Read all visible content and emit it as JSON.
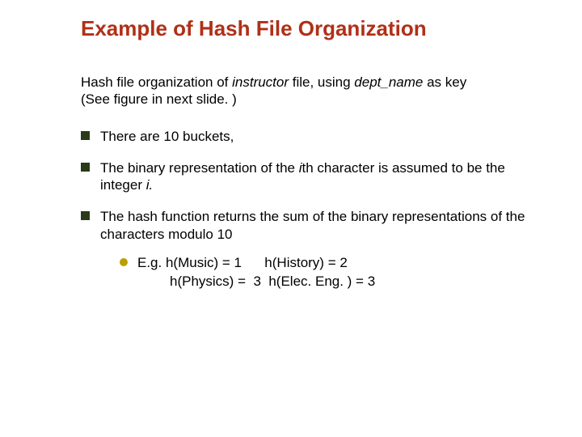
{
  "title": "Example of Hash File Organization",
  "intro": {
    "part1": "Hash file organization of ",
    "italic1": "instructor",
    "part2": " file, using ",
    "italic2": "dept_name",
    "part3": " as key",
    "line2": " (See figure in next slide. )"
  },
  "bullets": [
    {
      "text": "There are 10 buckets,"
    },
    {
      "pre": "The binary representation of the ",
      "ital": "i",
      "post": "th character is assumed to be the integer ",
      "ital2": "i.",
      "post2": ""
    },
    {
      "text": "The hash function returns the sum of the binary representations of the characters modulo 10",
      "sub": {
        "line1": "E.g. h(Music) = 1      h(History) = 2",
        "line2": "h(Physics) =  3  h(Elec. Eng. ) = 3"
      }
    }
  ]
}
